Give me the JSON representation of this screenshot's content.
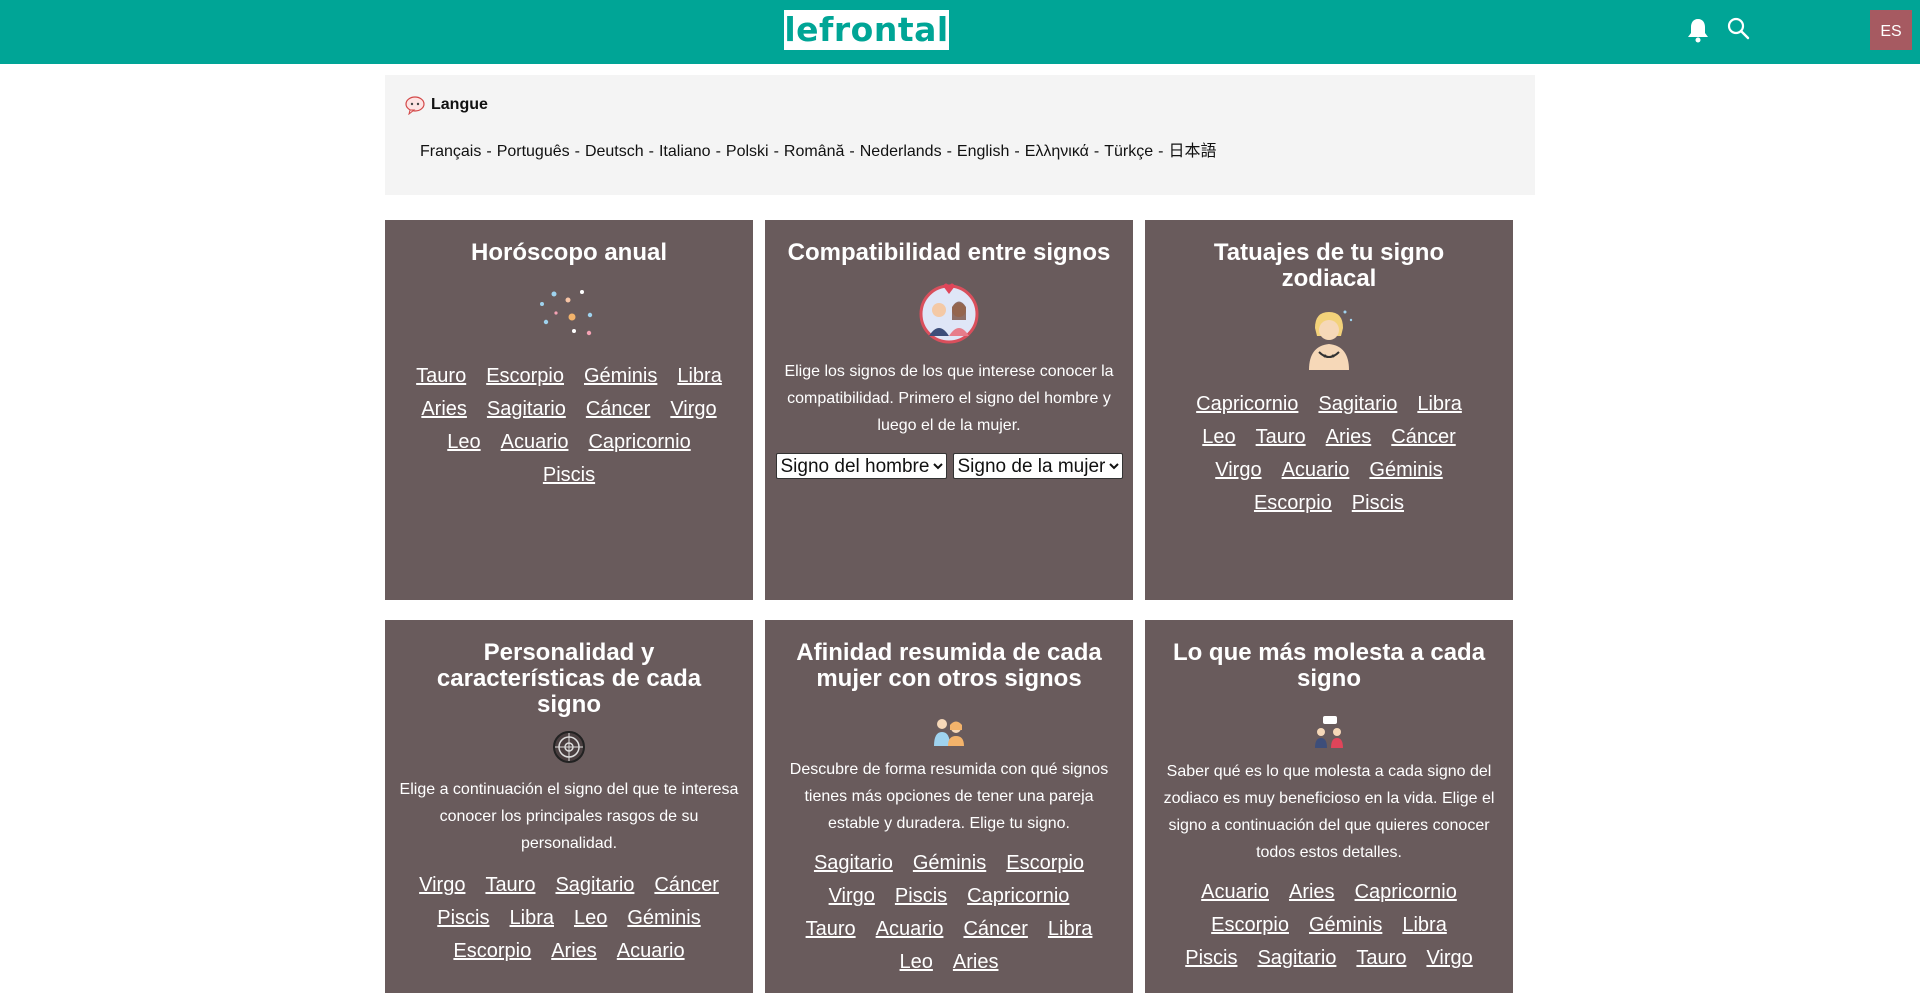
{
  "header": {
    "logo": "lefrontal",
    "menu_glyph": "",
    "language_code": "ES",
    "icons": [
      "bell-icon",
      "search-icon"
    ],
    "colors": {
      "bar": "#00a596",
      "badge": "#a65a61"
    }
  },
  "language_box": {
    "title": "Langue",
    "languages": [
      "Français",
      "Português",
      "Deutsch",
      "Italiano",
      "Polski",
      "Română",
      "Nederlands",
      "English",
      "Ελληνικά",
      "Türkçe",
      "日本語"
    ]
  },
  "cards": {
    "horoscope": {
      "title": "Horóscopo anual",
      "links": [
        "Tauro",
        "Escorpio",
        "Géminis",
        "Libra",
        "Aries",
        "Sagitario",
        "Cáncer",
        "Virgo",
        "Leo",
        "Acuario",
        "Capricornio",
        "Piscis"
      ]
    },
    "compat": {
      "title": "Compatibilidad entre signos",
      "desc": "Elige los signos de los que interese conocer la compatibilidad. Primero el signo del hombre y luego el de la mujer.",
      "select_man": "Signo del hombre",
      "select_woman": "Signo de la mujer"
    },
    "tattoo": {
      "title": "Tatuajes de tu signo zodiacal",
      "links": [
        "Capricornio",
        "Sagitario",
        "Libra",
        "Leo",
        "Tauro",
        "Aries",
        "Cáncer",
        "Virgo",
        "Acuario",
        "Géminis",
        "Escorpio",
        "Piscis"
      ]
    },
    "personality": {
      "title": "Personalidad y características de cada signo",
      "desc": "Elige a continuación el signo del que te interesa conocer los principales rasgos de su personalidad.",
      "links": [
        "Virgo",
        "Tauro",
        "Sagitario",
        "Cáncer",
        "Piscis",
        "Libra",
        "Leo",
        "Géminis",
        "Escorpio",
        "Aries",
        "Acuario"
      ]
    },
    "affinity": {
      "title": "Afinidad resumida de cada mujer con otros signos",
      "desc": "Descubre de forma resumida con qué signos tienes más opciones de tener una pareja estable y duradera. Elige tu signo.",
      "links": [
        "Sagitario",
        "Géminis",
        "Escorpio",
        "Virgo",
        "Piscis",
        "Capricornio",
        "Tauro",
        "Acuario",
        "Cáncer",
        "Libra",
        "Leo",
        "Aries"
      ]
    },
    "annoy": {
      "title": "Lo que más molesta a cada signo",
      "desc": "Saber qué es lo que molesta a cada signo del zodiaco es muy beneficioso en la vida. Elige el signo a continuación del que quieres conocer todos estos detalles.",
      "links": [
        "Acuario",
        "Aries",
        "Capricornio",
        "Escorpio",
        "Géminis",
        "Libra",
        "Piscis",
        "Sagitario",
        "Tauro",
        "Virgo"
      ]
    }
  }
}
